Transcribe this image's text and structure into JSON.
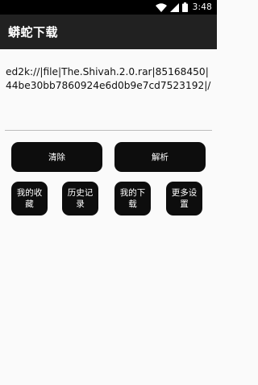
{
  "status_bar": {
    "time": "3:48",
    "icons": [
      "wifi-icon",
      "signal-icon",
      "battery-icon"
    ]
  },
  "app_bar": {
    "title": "蟒蛇下载"
  },
  "input": {
    "value": "ed2k://|file|The.Shivah.2.0.rar|85168450|44be30bb7860924e6d0b9e7cd7523192|/"
  },
  "buttons": {
    "clear": "清除",
    "parse": "解析",
    "favorites": "我的收藏",
    "history": "历史记录",
    "downloads": "我的下载",
    "more_settings": "更多设置"
  },
  "colors": {
    "status_bar": "#000000",
    "app_bar": "#212121",
    "button": "#0d0d0d",
    "background": "#fafafa",
    "divider": "#bdbdbd"
  }
}
